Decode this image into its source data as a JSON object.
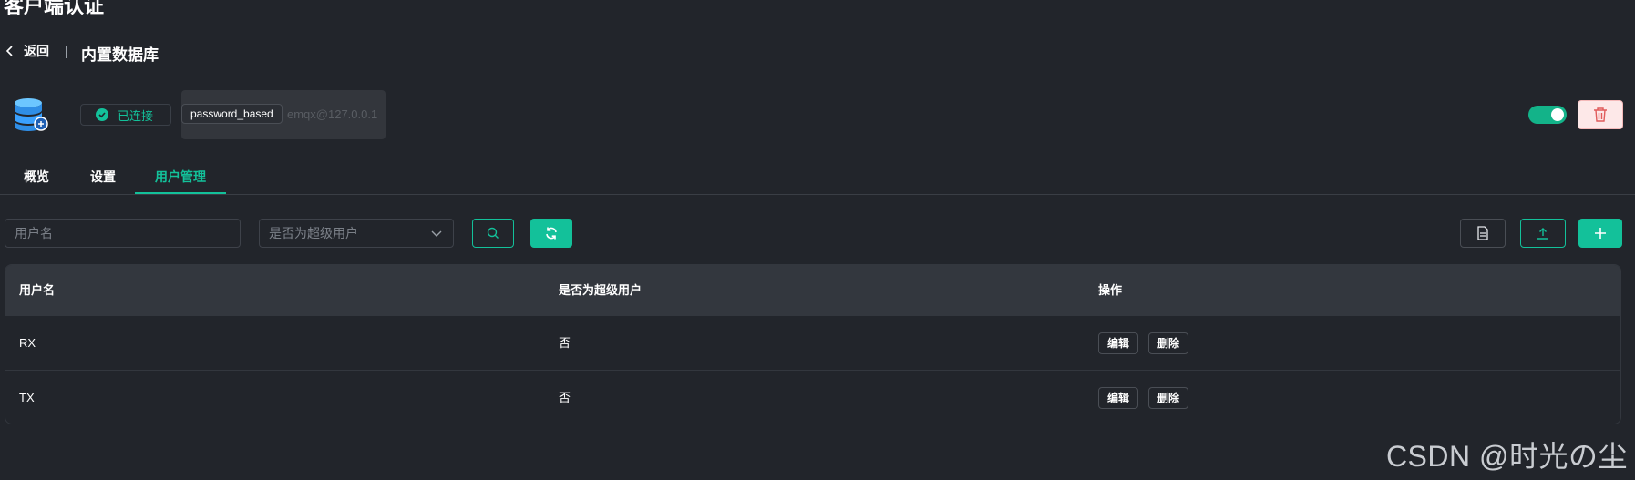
{
  "page": {
    "title": "客户端认证"
  },
  "breadcrumb": {
    "back_label": "返回",
    "current": "内置数据库"
  },
  "header": {
    "icon": "database-icon",
    "status": "已连接",
    "tooltip": "password_based",
    "info_text": "emqx@127.0.0.1",
    "enabled": true
  },
  "tabs": [
    {
      "label": "概览",
      "active": false
    },
    {
      "label": "设置",
      "active": false
    },
    {
      "label": "用户管理",
      "active": true
    }
  ],
  "toolbar": {
    "username_placeholder": "用户名",
    "superuser_placeholder": "是否为超级用户"
  },
  "table": {
    "columns": [
      "用户名",
      "是否为超级用户",
      "操作"
    ],
    "rows": [
      {
        "username": "RX",
        "is_superuser": "否"
      },
      {
        "username": "TX",
        "is_superuser": "否"
      }
    ],
    "actions": {
      "edit": "编辑",
      "delete": "删除"
    }
  },
  "watermark": "CSDN @时光の尘",
  "colors": {
    "accent": "#13c19a",
    "background": "#22252b",
    "danger": "#e05b5b"
  }
}
